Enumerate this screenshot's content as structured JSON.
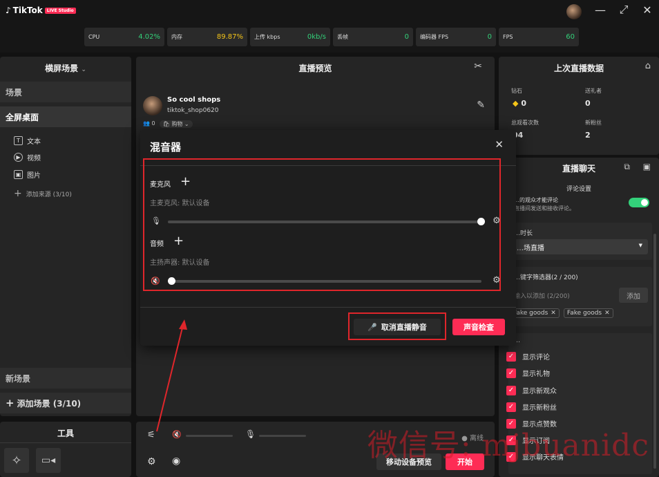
{
  "app": {
    "logo_text": "TikTok",
    "logo_badge": "LIVE Studio"
  },
  "window": {
    "minimize": "—",
    "maximize": "⤢",
    "close": "✕"
  },
  "stats": [
    {
      "label": "CPU",
      "value": "4.02%",
      "color": "#33d17a"
    },
    {
      "label": "内存",
      "value": "89.87%",
      "color": "#f5c518"
    },
    {
      "label": "上传 kbps",
      "value": "0kb/s",
      "color": "#33d17a"
    },
    {
      "label": "丢帧",
      "value": "0",
      "color": "#33d17a"
    },
    {
      "label": "编码器 FPS",
      "value": "0",
      "color": "#33d17a"
    },
    {
      "label": "FPS",
      "value": "60",
      "color": "#33d17a"
    }
  ],
  "scenes": {
    "header": "横屏场景",
    "section_label": "场景",
    "active_scene": "全屏桌面",
    "sources": [
      {
        "icon": "T",
        "label": "文本"
      },
      {
        "icon": "▶",
        "label": "视频"
      },
      {
        "icon": "▣",
        "label": "图片"
      }
    ],
    "add_source": "添加来源 (3/10)",
    "new_scene": "新场景",
    "add_scene": "添加场景 (3/10)"
  },
  "tools": {
    "header": "工具"
  },
  "preview": {
    "header": "直播预览",
    "shop_name": "So cool shops",
    "shop_handle": "tiktok_shop0620",
    "viewers": "0",
    "shop_chip": "购物"
  },
  "mixer": {
    "title": "混音器",
    "mic_label": "麦克风",
    "mic_device": "主麦克风: 默认设备",
    "audio_label": "音频",
    "audio_device": "主扬声器: 默认设备",
    "mic_level": 1.0,
    "audio_level": 0.0,
    "unmute_button": "取消直播静音",
    "sound_check_button": "声音检查"
  },
  "bottom_bar": {
    "status": "离线",
    "mobile_preview": "移动设备预览",
    "start": "开始"
  },
  "last_live": {
    "header": "上次直播数据",
    "diamonds_label": "钻石",
    "diamonds_value": "0",
    "gifters_label": "送礼者",
    "gifters_value": "0",
    "total_views_label": "总观看次数",
    "total_views_value": "04",
    "new_followers_label": "新粉丝",
    "new_followers_value": "2"
  },
  "live_chat": {
    "header": "直播聊天",
    "settings_tab": "评论设置",
    "partial_line1": "…的观众才能评论",
    "partial_line2": "直播间发送和接收评论。",
    "duration_label": "…时长",
    "duration_value": "…场直播",
    "keyword_label": "…键字筛选器(2 / 200)",
    "keyword_placeholder": "输入以添加 (2/200)",
    "add_button": "添加",
    "tags": [
      "Fake goods",
      "Fake goods"
    ],
    "show_section": "…",
    "checkboxes": [
      "显示评论",
      "显示礼物",
      "显示新观众",
      "显示新粉丝",
      "显示点赞数",
      "显示订阅",
      "显示聊天表情"
    ]
  },
  "watermark": "微信号: mjbuanidc"
}
